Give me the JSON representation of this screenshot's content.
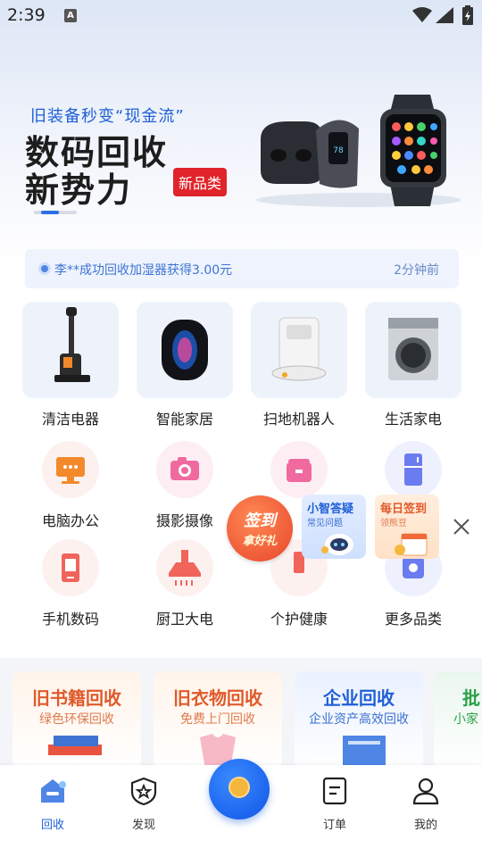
{
  "status_bar": {
    "time": "2:39",
    "notif_icon": "A"
  },
  "banner": {
    "subtitle": "旧装备秒变“现金流”",
    "line1": "数码回收",
    "line2": "新势力",
    "badge": "新品类"
  },
  "notice": {
    "message": "李**成功回收加湿器获得3.00元",
    "time_ago": "2分钟前"
  },
  "categories_top": [
    {
      "label": "清洁电器",
      "icon": "vacuum-icon"
    },
    {
      "label": "智能家居",
      "icon": "smart-speaker-icon"
    },
    {
      "label": "扫地机器人",
      "icon": "robot-vacuum-icon"
    },
    {
      "label": "生活家电",
      "icon": "washing-machine-icon"
    }
  ],
  "categories_bottom": [
    {
      "label": "电脑办公",
      "icon": "monitor-icon"
    },
    {
      "label": "摄影摄像",
      "icon": "camera-icon"
    },
    {
      "label": "",
      "icon": "rice-cooker-icon"
    },
    {
      "label": "",
      "icon": "fridge-icon"
    },
    {
      "label": "手机数码",
      "icon": "phone-icon"
    },
    {
      "label": "厨卫大电",
      "icon": "range-hood-icon"
    },
    {
      "label": "个护健康",
      "icon": "health-icon"
    },
    {
      "label": "更多品类",
      "icon": "more-icon"
    }
  ],
  "floating": {
    "sign_in": {
      "line1": "签到",
      "line2": "拿好礼"
    },
    "assistant": {
      "title": "小智答疑",
      "subtitle": "常见问题"
    },
    "daily": {
      "title": "每日签到",
      "subtitle": "领熊豆"
    }
  },
  "services": [
    {
      "title": "旧书籍回收",
      "subtitle": "绿色环保回收",
      "color": "#e05a2b"
    },
    {
      "title": "旧衣物回收",
      "subtitle": "免费上门回收",
      "color": "#e05a2b"
    },
    {
      "title": "企业回收",
      "subtitle": "企业资产高效回收",
      "color": "#1f5fd8"
    },
    {
      "title": "批",
      "subtitle": "小家",
      "color": "#2aa04a"
    }
  ],
  "nav": [
    {
      "label": "回收",
      "icon": "recycle-home-icon",
      "active": true
    },
    {
      "label": "发现",
      "icon": "discover-icon",
      "active": false
    },
    {
      "label": "订单",
      "icon": "order-icon",
      "active": false
    },
    {
      "label": "我的",
      "icon": "profile-icon",
      "active": false
    }
  ],
  "colors": {
    "accent": "#1f5fd8",
    "badge": "#e0242a",
    "sign": "#e8452a"
  }
}
